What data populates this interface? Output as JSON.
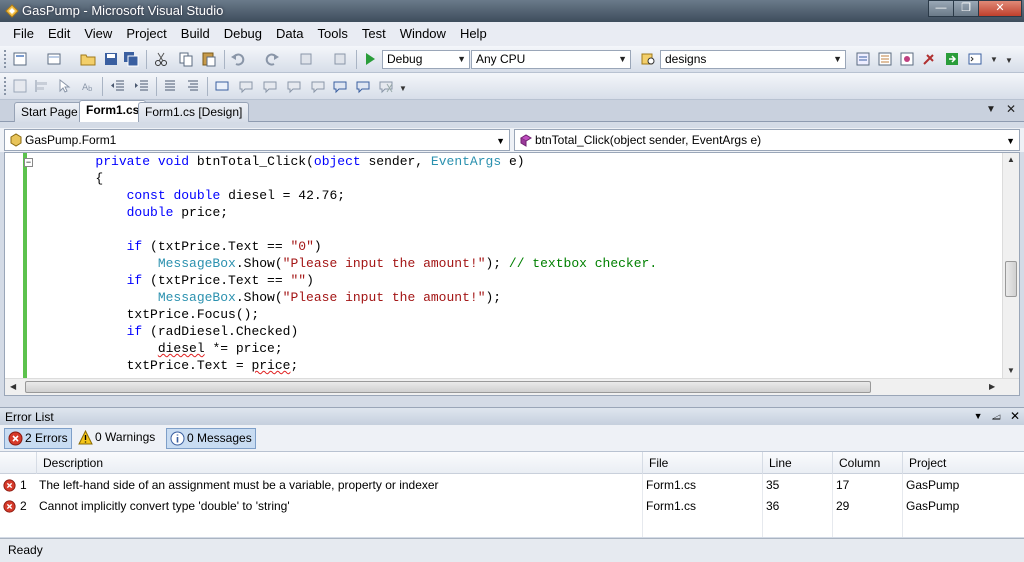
{
  "window": {
    "title": "GasPump - Microsoft Visual Studio"
  },
  "menu": [
    "File",
    "Edit",
    "View",
    "Project",
    "Build",
    "Debug",
    "Data",
    "Tools",
    "Test",
    "Window",
    "Help"
  ],
  "toolbar": {
    "config": "Debug",
    "platform": "Any CPU",
    "find": "designs"
  },
  "tabs": [
    {
      "label": "Start Page",
      "active": false
    },
    {
      "label": "Form1.cs",
      "active": true
    },
    {
      "label": "Form1.cs [Design]",
      "active": false
    }
  ],
  "navbar": {
    "type": "GasPump.Form1",
    "member": "btnTotal_Click(object sender, EventArgs e)"
  },
  "code": {
    "line1": {
      "indent": "        ",
      "kw1": "private",
      "kw2": "void",
      "rest": " btnTotal_Click(",
      "kw3": "object",
      "mid": " sender, ",
      "ty": "EventArgs",
      "end": " e)"
    },
    "line2": "        {",
    "line3": {
      "indent": "            ",
      "kw1": "const",
      "kw2": "double",
      "rest": " diesel = 42.76;"
    },
    "line4": {
      "indent": "            ",
      "kw": "double",
      "rest": " price;"
    },
    "line5": "",
    "line6": {
      "indent": "            ",
      "kw": "if",
      "rest": " (txtPrice.Text == ",
      "st": "\"0\"",
      "end": ")"
    },
    "line7": {
      "indent": "                ",
      "ty": "MessageBox",
      "rest": ".Show(",
      "st": "\"Please input the amount!\"",
      "end": "); ",
      "cm": "// textbox checker."
    },
    "line8": {
      "indent": "            ",
      "kw": "if",
      "rest": " (txtPrice.Text == ",
      "st": "\"\"",
      "end": ")"
    },
    "line9": {
      "indent": "                ",
      "ty": "MessageBox",
      "rest": ".Show(",
      "st": "\"Please input the amount!\"",
      "end": ");"
    },
    "line10": "            txtPrice.Focus();",
    "line11": {
      "indent": "            ",
      "kw": "if",
      "rest": " (radDiesel.Checked)"
    },
    "line12": {
      "indent": "                ",
      "sq": "diesel",
      "rest": " *= price;"
    },
    "line13": {
      "indent": "            ",
      "pre": "txtPrice.Text = ",
      "sq": "price",
      "end": ";"
    }
  },
  "error_list": {
    "title": "Error List",
    "filters": {
      "errors": "2 Errors",
      "warnings": "0 Warnings",
      "messages": "0 Messages"
    },
    "columns": [
      "Description",
      "File",
      "Line",
      "Column",
      "Project"
    ],
    "rows": [
      {
        "num": "1",
        "description": "The left-hand side of an assignment must be a variable, property or indexer",
        "file": "Form1.cs",
        "line": "35",
        "column": "17",
        "project": "GasPump"
      },
      {
        "num": "2",
        "description": "Cannot implicitly convert type 'double' to 'string'",
        "file": "Form1.cs",
        "line": "36",
        "column": "29",
        "project": "GasPump"
      }
    ]
  },
  "status": "Ready"
}
